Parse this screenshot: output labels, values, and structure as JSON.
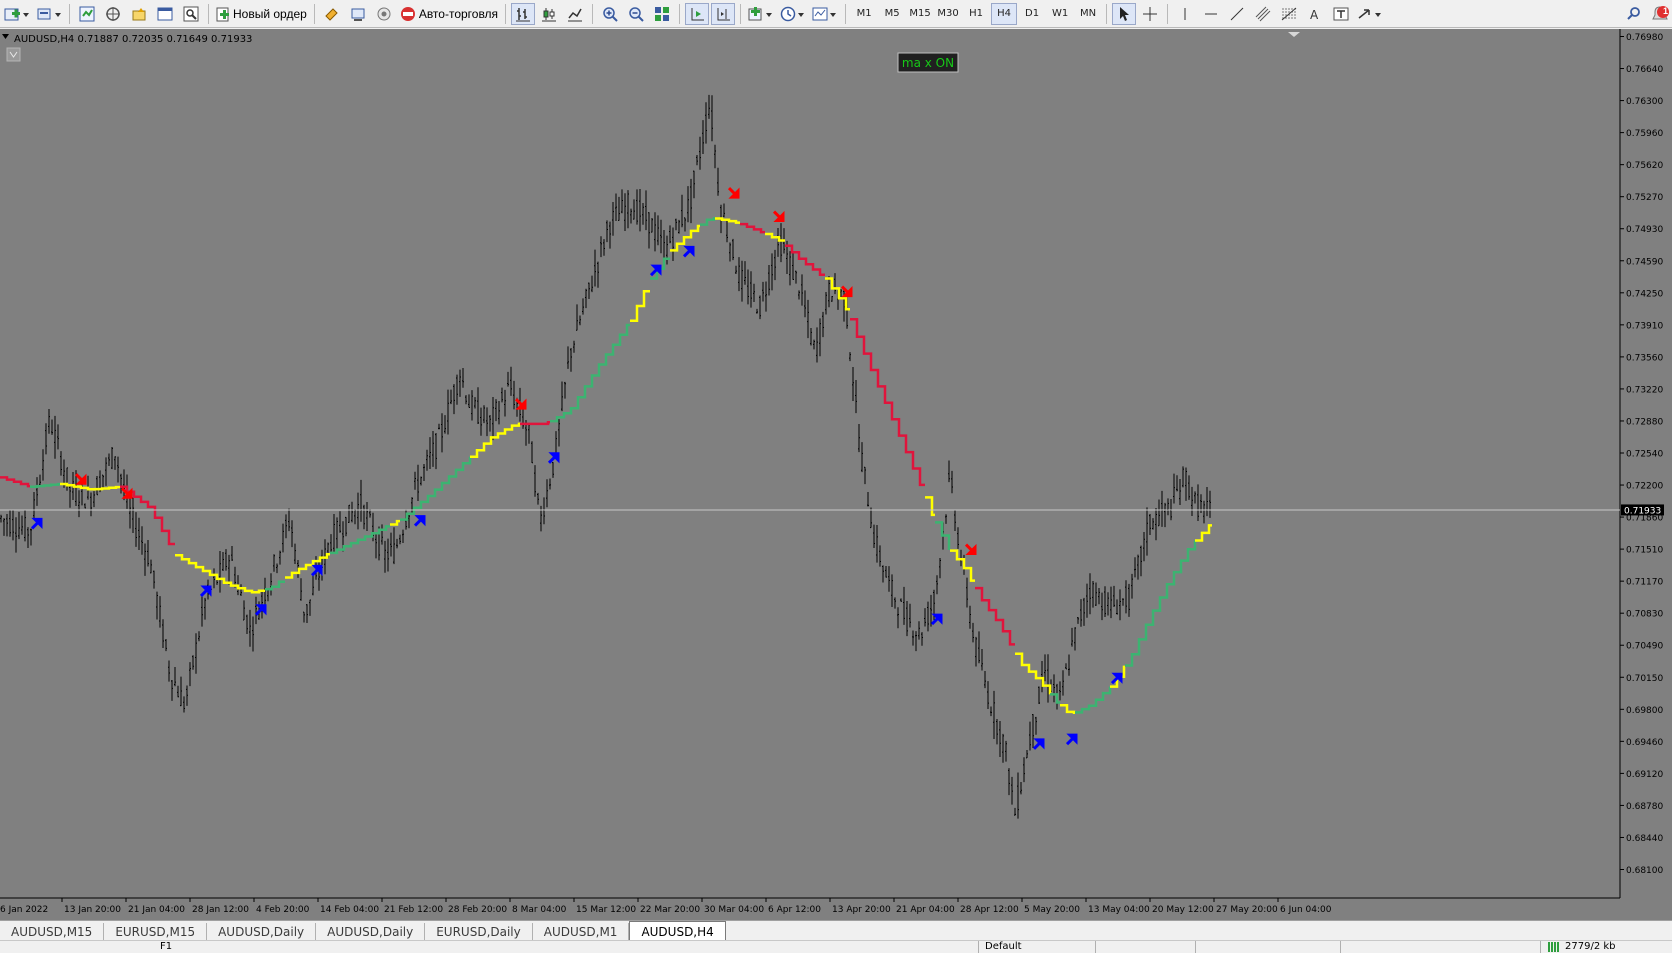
{
  "toolbar": {
    "new_order_label": "Новый ордер",
    "autotrading_label": "Авто-торговля",
    "timeframes": [
      "M1",
      "M5",
      "M15",
      "M30",
      "H1",
      "H4",
      "D1",
      "W1",
      "MN"
    ],
    "active_timeframe": "H4",
    "notification_count": "1"
  },
  "chart": {
    "info_line": "AUDUSD,H4  0.71887 0.72035 0.71649 0.71933",
    "ma_button": "ma x ON",
    "current_price_label": "0.71933",
    "background": "#808080",
    "candle_color": "#000000",
    "ma_colors": {
      "up": "#3cb371",
      "flat": "#ffff00",
      "down": "#e0143c"
    },
    "arrow_colors": {
      "buy": "#0000ff",
      "sell": "#ff0000"
    }
  },
  "chart_data": {
    "type": "line",
    "symbol": "AUDUSD",
    "timeframe": "H4",
    "ohlc": {
      "open": 0.71887,
      "high": 0.72035,
      "low": 0.71649,
      "close": 0.71933
    },
    "ylim": [
      0.681,
      0.7715
    ],
    "y_ticks": [
      "0.76980",
      "0.76640",
      "0.76300",
      "0.75960",
      "0.75620",
      "0.75270",
      "0.74930",
      "0.74590",
      "0.74250",
      "0.73910",
      "0.73560",
      "0.73220",
      "0.72880",
      "0.72540",
      "0.72200",
      "0.71860",
      "0.71510",
      "0.71170",
      "0.70830",
      "0.70490",
      "0.70150",
      "0.69800",
      "0.69460",
      "0.69120",
      "0.68780",
      "0.68440",
      "0.68100"
    ],
    "x_ticks": [
      "6 Jan 2022",
      "13 Jan 20:00",
      "21 Jan 04:00",
      "28 Jan 12:00",
      "4 Feb 20:00",
      "14 Feb 04:00",
      "21 Feb 12:00",
      "28 Feb 20:00",
      "8 Mar 04:00",
      "15 Mar 12:00",
      "22 Mar 20:00",
      "30 Mar 04:00",
      "6 Apr 12:00",
      "13 Apr 20:00",
      "21 Apr 04:00",
      "28 Apr 12:00",
      "5 May 20:00",
      "13 May 04:00",
      "20 May 12:00",
      "27 May 20:00",
      "6 Jun 04:00"
    ],
    "price_path": [
      [
        0,
        0.7185
      ],
      [
        30,
        0.717
      ],
      [
        50,
        0.729
      ],
      [
        70,
        0.7215
      ],
      [
        90,
        0.7205
      ],
      [
        115,
        0.7255
      ],
      [
        130,
        0.719
      ],
      [
        150,
        0.714
      ],
      [
        170,
        0.702
      ],
      [
        185,
        0.6985
      ],
      [
        205,
        0.7095
      ],
      [
        230,
        0.7145
      ],
      [
        250,
        0.7065
      ],
      [
        270,
        0.712
      ],
      [
        290,
        0.7185
      ],
      [
        305,
        0.708
      ],
      [
        330,
        0.716
      ],
      [
        360,
        0.72
      ],
      [
        385,
        0.7145
      ],
      [
        395,
        0.715
      ],
      [
        415,
        0.7215
      ],
      [
        440,
        0.727
      ],
      [
        460,
        0.734
      ],
      [
        470,
        0.7305
      ],
      [
        490,
        0.7285
      ],
      [
        510,
        0.7325
      ],
      [
        530,
        0.727
      ],
      [
        540,
        0.718
      ],
      [
        555,
        0.725
      ],
      [
        570,
        0.736
      ],
      [
        590,
        0.743
      ],
      [
        610,
        0.75
      ],
      [
        630,
        0.752
      ],
      [
        650,
        0.75
      ],
      [
        665,
        0.747
      ],
      [
        690,
        0.752
      ],
      [
        710,
        0.763
      ],
      [
        720,
        0.752
      ],
      [
        740,
        0.744
      ],
      [
        760,
        0.741
      ],
      [
        780,
        0.748
      ],
      [
        800,
        0.743
      ],
      [
        815,
        0.736
      ],
      [
        830,
        0.743
      ],
      [
        845,
        0.742
      ],
      [
        860,
        0.726
      ],
      [
        875,
        0.716
      ],
      [
        890,
        0.711
      ],
      [
        905,
        0.708
      ],
      [
        920,
        0.706
      ],
      [
        935,
        0.71
      ],
      [
        950,
        0.723
      ],
      [
        960,
        0.715
      ],
      [
        975,
        0.705
      ],
      [
        990,
        0.699
      ],
      [
        1005,
        0.694
      ],
      [
        1015,
        0.687
      ],
      [
        1030,
        0.695
      ],
      [
        1045,
        0.702
      ],
      [
        1060,
        0.699
      ],
      [
        1075,
        0.706
      ],
      [
        1090,
        0.711
      ],
      [
        1110,
        0.709
      ],
      [
        1130,
        0.71
      ],
      [
        1150,
        0.718
      ],
      [
        1170,
        0.7195
      ],
      [
        1185,
        0.723
      ],
      [
        1195,
        0.72
      ],
      [
        1212,
        0.719
      ]
    ],
    "moving_average": [
      [
        0,
        0.7228
      ],
      [
        30,
        0.7218
      ],
      [
        60,
        0.7221
      ],
      [
        90,
        0.7215
      ],
      [
        120,
        0.7218
      ],
      [
        150,
        0.7195
      ],
      [
        175,
        0.7145
      ],
      [
        200,
        0.713
      ],
      [
        225,
        0.7115
      ],
      [
        250,
        0.7105
      ],
      [
        270,
        0.711
      ],
      [
        290,
        0.7125
      ],
      [
        315,
        0.714
      ],
      [
        345,
        0.7155
      ],
      [
        375,
        0.717
      ],
      [
        400,
        0.7183
      ],
      [
        430,
        0.721
      ],
      [
        460,
        0.724
      ],
      [
        490,
        0.727
      ],
      [
        515,
        0.7285
      ],
      [
        545,
        0.7285
      ],
      [
        570,
        0.73
      ],
      [
        600,
        0.735
      ],
      [
        630,
        0.7395
      ],
      [
        650,
        0.744
      ],
      [
        670,
        0.747
      ],
      [
        690,
        0.749
      ],
      [
        710,
        0.7505
      ],
      [
        735,
        0.75
      ],
      [
        760,
        0.749
      ],
      [
        780,
        0.748
      ],
      [
        800,
        0.746
      ],
      [
        825,
        0.744
      ],
      [
        845,
        0.741
      ],
      [
        860,
        0.737
      ],
      [
        880,
        0.732
      ],
      [
        900,
        0.727
      ],
      [
        920,
        0.722
      ],
      [
        935,
        0.718
      ],
      [
        950,
        0.715
      ],
      [
        965,
        0.713
      ],
      [
        980,
        0.71
      ],
      [
        1000,
        0.707
      ],
      [
        1020,
        0.703
      ],
      [
        1040,
        0.701
      ],
      [
        1055,
        0.699
      ],
      [
        1070,
        0.6975
      ],
      [
        1090,
        0.6985
      ],
      [
        1110,
        0.7005
      ],
      [
        1130,
        0.7035
      ],
      [
        1150,
        0.708
      ],
      [
        1170,
        0.712
      ],
      [
        1190,
        0.7155
      ],
      [
        1210,
        0.7178
      ]
    ],
    "ma_segments": [
      [
        0,
        30,
        "down"
      ],
      [
        30,
        60,
        "up"
      ],
      [
        60,
        120,
        "flat"
      ],
      [
        120,
        175,
        "down"
      ],
      [
        175,
        265,
        "flat"
      ],
      [
        265,
        285,
        "up"
      ],
      [
        285,
        330,
        "flat"
      ],
      [
        330,
        390,
        "up"
      ],
      [
        390,
        400,
        "flat"
      ],
      [
        400,
        470,
        "up"
      ],
      [
        470,
        520,
        "flat"
      ],
      [
        520,
        550,
        "down"
      ],
      [
        550,
        630,
        "up"
      ],
      [
        630,
        650,
        "flat"
      ],
      [
        650,
        670,
        "up"
      ],
      [
        670,
        700,
        "flat"
      ],
      [
        700,
        715,
        "up"
      ],
      [
        715,
        740,
        "flat"
      ],
      [
        740,
        765,
        "down"
      ],
      [
        765,
        785,
        "flat"
      ],
      [
        785,
        825,
        "down"
      ],
      [
        825,
        850,
        "flat"
      ],
      [
        850,
        925,
        "down"
      ],
      [
        925,
        935,
        "flat"
      ],
      [
        935,
        950,
        "up"
      ],
      [
        950,
        975,
        "flat"
      ],
      [
        975,
        1015,
        "down"
      ],
      [
        1015,
        1050,
        "flat"
      ],
      [
        1050,
        1060,
        "up"
      ],
      [
        1060,
        1075,
        "flat"
      ],
      [
        1075,
        1110,
        "up"
      ],
      [
        1110,
        1125,
        "flat"
      ],
      [
        1125,
        1195,
        "up"
      ],
      [
        1195,
        1212,
        "flat"
      ]
    ],
    "buy_arrows": [
      [
        38,
        0.718
      ],
      [
        207,
        0.7108
      ],
      [
        262,
        0.7088
      ],
      [
        318,
        0.713
      ],
      [
        421,
        0.7183
      ],
      [
        555,
        0.725
      ],
      [
        657,
        0.745
      ],
      [
        690,
        0.747
      ],
      [
        938,
        0.7078
      ],
      [
        1040,
        0.6945
      ],
      [
        1073,
        0.695
      ],
      [
        1118,
        0.7015
      ]
    ],
    "sell_arrows": [
      [
        82,
        0.7225
      ],
      [
        128,
        0.721
      ],
      [
        522,
        0.7305
      ],
      [
        735,
        0.753
      ],
      [
        780,
        0.7505
      ],
      [
        848,
        0.7425
      ],
      [
        972,
        0.715
      ]
    ]
  },
  "tabs": [
    "AUDUSD,M15",
    "EURUSD,M15",
    "AUDUSD,Daily",
    "AUDUSD,Daily",
    "EURUSD,Daily",
    "AUDUSD,M1",
    "AUDUSD,H4"
  ],
  "active_tab": "AUDUSD,H4",
  "status": {
    "help": "F1",
    "profile": "Default",
    "traffic": "2779/2 kb"
  }
}
